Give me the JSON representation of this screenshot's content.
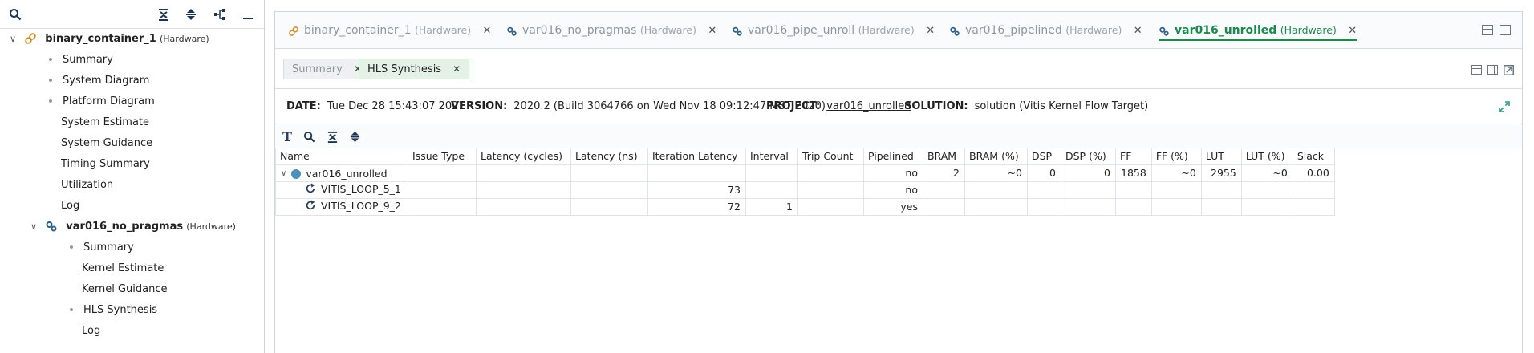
{
  "explorer": {
    "tree": [
      {
        "label": "binary_container_1",
        "kind": "(Hardware)"
      },
      {
        "label": "Summary"
      },
      {
        "label": "System Diagram"
      },
      {
        "label": "Platform Diagram"
      },
      {
        "label": "System Estimate"
      },
      {
        "label": "System Guidance"
      },
      {
        "label": "Timing Summary"
      },
      {
        "label": "Utilization"
      },
      {
        "label": "Log"
      },
      {
        "label": "var016_no_pragmas",
        "kind": "(Hardware)"
      },
      {
        "label": "Summary"
      },
      {
        "label": "Kernel Estimate"
      },
      {
        "label": "Kernel Guidance"
      },
      {
        "label": "HLS Synthesis"
      },
      {
        "label": "Log"
      }
    ]
  },
  "tabs": [
    {
      "title": "binary_container_1",
      "kind": "(Hardware)",
      "close": "✕"
    },
    {
      "title": "var016_no_pragmas",
      "kind": "(Hardware)",
      "close": "✕"
    },
    {
      "title": "var016_pipe_unroll",
      "kind": "(Hardware)",
      "close": "✕"
    },
    {
      "title": "var016_pipelined",
      "kind": "(Hardware)",
      "close": "✕"
    },
    {
      "title": "var016_unrolled",
      "kind": "(Hardware)",
      "close": "✕"
    }
  ],
  "subtabs": [
    {
      "label": "Summary",
      "close": "✕"
    },
    {
      "label": "HLS Synthesis",
      "close": "✕"
    }
  ],
  "info": {
    "date_label": "DATE:",
    "date": "Tue Dec 28 15:43:07 2021",
    "version_label": "VERSION:",
    "version": "2020.2 (Build 3064766 on Wed Nov 18 09:12:47 MST 2020)",
    "project_label": "PROJECT:",
    "project": "var016_unrolled",
    "solution_label": "SOLUTION:",
    "solution": "solution (Vitis Kernel Flow Target)"
  },
  "table": {
    "columns": [
      "Name",
      "Issue Type",
      "Latency (cycles)",
      "Latency (ns)",
      "Iteration Latency",
      "Interval",
      "Trip Count",
      "Pipelined",
      "BRAM",
      "BRAM (%)",
      "DSP",
      "DSP (%)",
      "FF",
      "FF (%)",
      "LUT",
      "LUT (%)",
      "Slack"
    ],
    "rows": [
      [
        "var016_unrolled",
        "",
        "",
        "",
        "",
        "",
        "",
        "no",
        "2",
        "~0",
        "0",
        "0",
        "1858",
        "~0",
        "2955",
        "~0",
        "0.00"
      ],
      [
        "VITIS_LOOP_5_1",
        "",
        "",
        "",
        "73",
        "",
        "",
        "no",
        "",
        "",
        "",
        "",
        "",
        "",
        "",
        "",
        ""
      ],
      [
        "VITIS_LOOP_9_2",
        "",
        "",
        "",
        "72",
        "1",
        "",
        "yes",
        "",
        "",
        "",
        "",
        "",
        "",
        "",
        "",
        ""
      ]
    ]
  },
  "colors": {
    "accent": "#1b8a4d",
    "link_chain": "#d08c2a",
    "node_dot": "#4a90b8"
  }
}
